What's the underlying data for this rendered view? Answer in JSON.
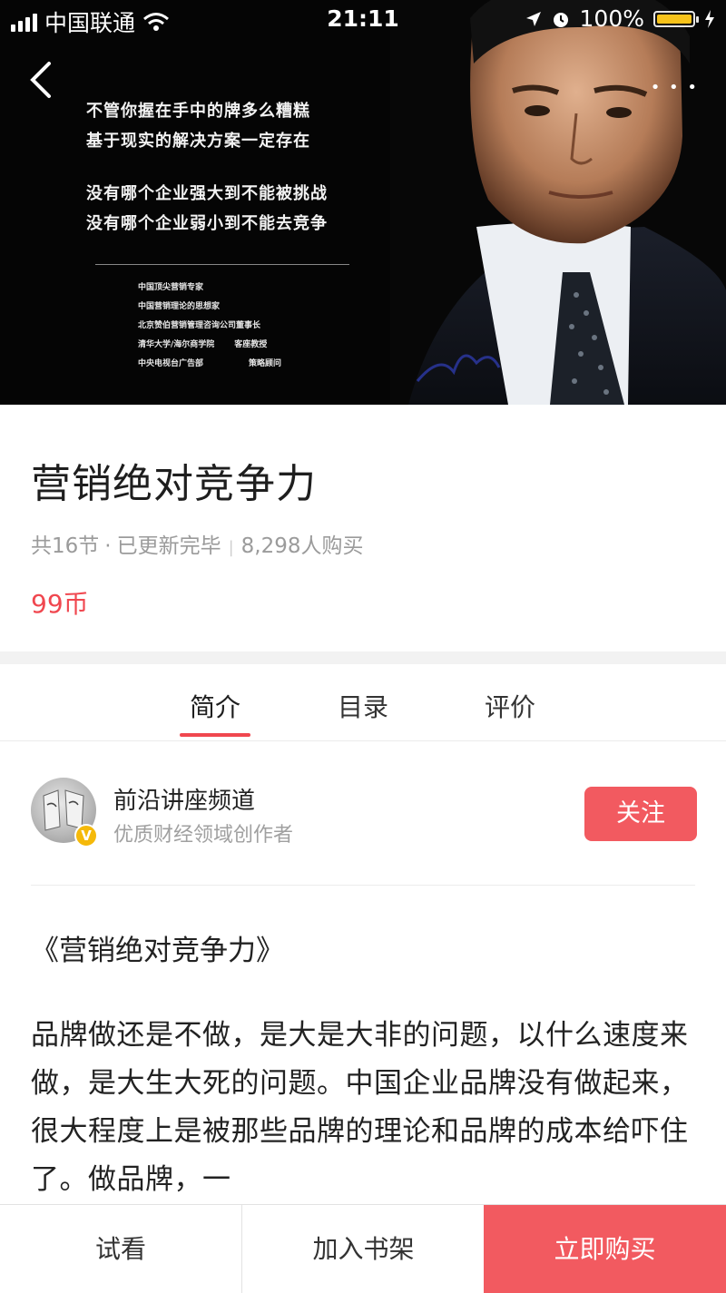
{
  "status_bar": {
    "carrier": "中国联通",
    "time": "21:11",
    "battery_text": "100%",
    "battery_color": "#f7c31b"
  },
  "hero": {
    "quote_lines_1": [
      "不管你握在手中的牌多么糟糕",
      "基于现实的解决方案一定存在"
    ],
    "quote_lines_2": [
      "没有哪个企业强大到不能被挑战",
      "没有哪个企业弱小到不能去竞争"
    ],
    "credits": [
      [
        "中国顶尖营销专家",
        ""
      ],
      [
        "中国营销理论的思想家",
        ""
      ],
      [
        "北京赞伯营销管理咨询公司董事长",
        ""
      ],
      [
        "清华大学/海尔商学院",
        "客座教授"
      ],
      [
        "中央电视台广告部",
        "策略顾问"
      ]
    ]
  },
  "course": {
    "title": "营销绝对竞争力",
    "sections": "共16节",
    "status": "已更新完毕",
    "buyers": "8,298人购买",
    "price": "99币",
    "accent_color": "#f0474f"
  },
  "tabs": [
    {
      "label": "简介",
      "active": true
    },
    {
      "label": "目录",
      "active": false
    },
    {
      "label": "评价",
      "active": false
    }
  ],
  "author": {
    "name": "前沿讲座频道",
    "description": "优质财经领域创作者",
    "badge": "V",
    "follow_label": "关注"
  },
  "intro": {
    "book_title": "《营销绝对竞争力》",
    "text": "品牌做还是不做，是大是大非的问题，以什么速度来做，是大生大死的问题。中国企业品牌没有做起来，很大程度上是被那些品牌的理论和品牌的成本给吓住了。做品牌，一"
  },
  "bottom_bar": {
    "trial_label": "试看",
    "shelf_label": "加入书架",
    "buy_label": "立即购买",
    "buy_color": "#f25a60"
  }
}
